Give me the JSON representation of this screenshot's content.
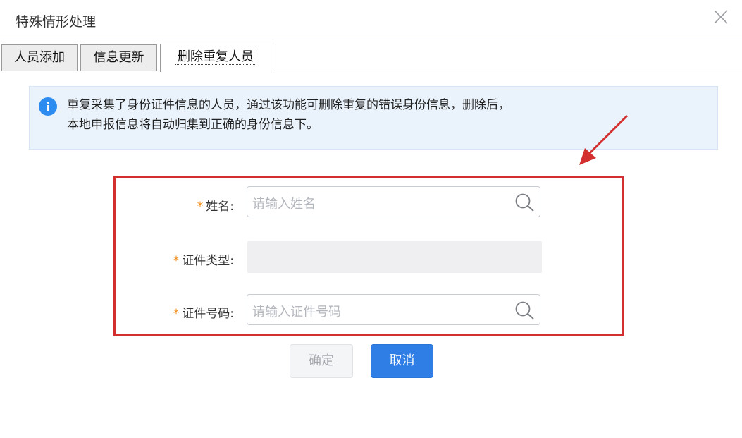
{
  "dialog": {
    "title": "特殊情形处理"
  },
  "tabs": [
    {
      "label": "人员添加",
      "active": false
    },
    {
      "label": "信息更新",
      "active": false
    },
    {
      "label": "删除重复人员",
      "active": true
    }
  ],
  "notice": {
    "line1": "重复采集了身份证件信息的人员，通过该功能可删除重复的错误身份信息，删除后，",
    "line2": "本地申报信息将自动归集到正确的身份信息下。"
  },
  "form": {
    "required_mark": "*",
    "name_label": "姓名:",
    "name_placeholder": "请输入姓名",
    "id_type_label": "证件类型:",
    "id_type_value": "",
    "id_number_label": "证件号码:",
    "id_number_placeholder": "请输入证件号码"
  },
  "buttons": {
    "confirm": "确定",
    "cancel": "取消"
  },
  "colors": {
    "accent": "#2f7ee5",
    "highlight_border": "#d42f2f",
    "required": "#f08b1a",
    "info_background": "#eaf3fc"
  }
}
